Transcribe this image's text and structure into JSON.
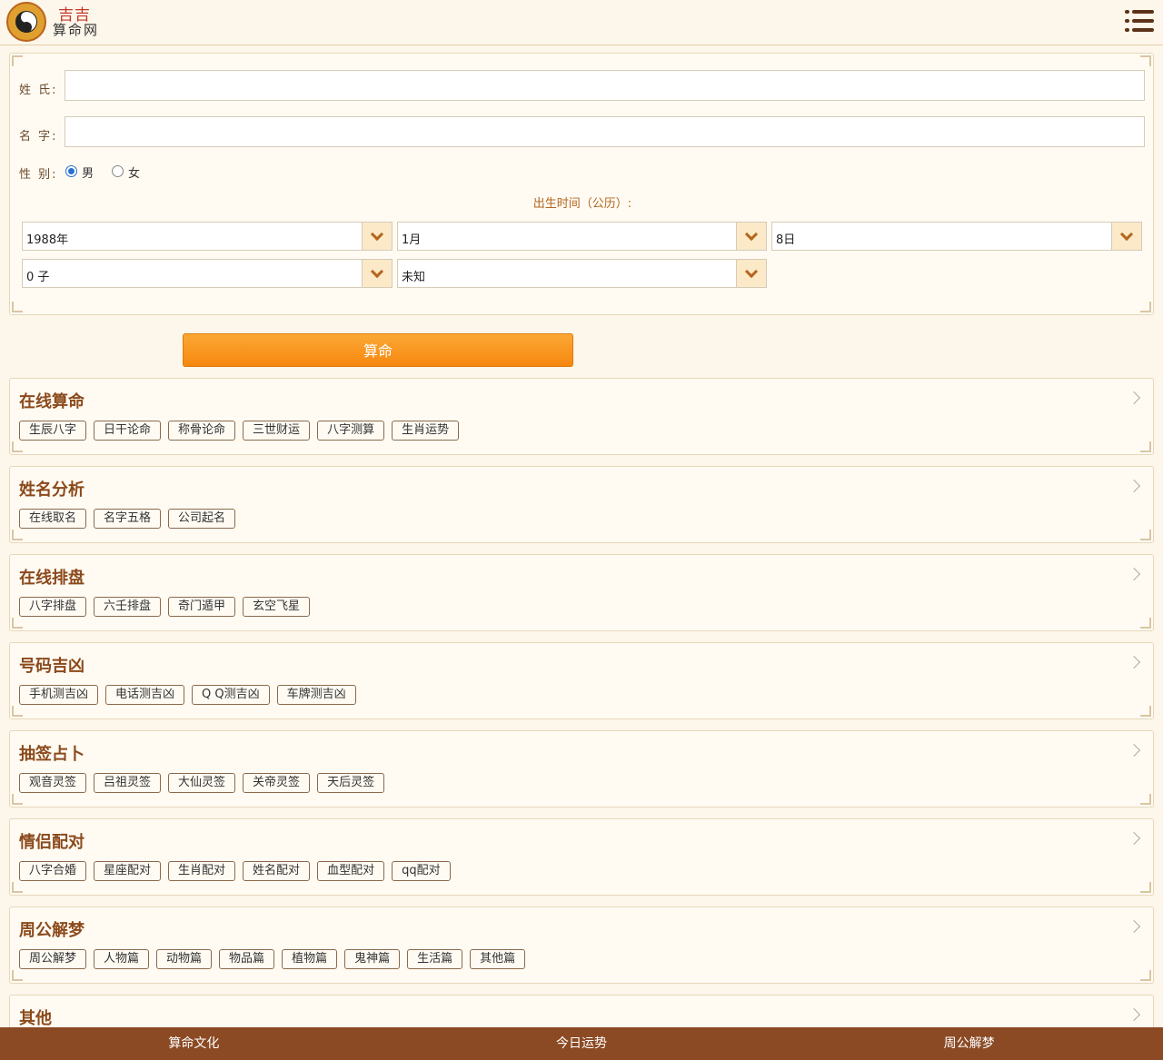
{
  "header": {
    "logo_top": "吉吉",
    "logo_bottom": "算命网",
    "menu_icon": "list-menu-icon"
  },
  "form": {
    "surname_label": "姓 氏:",
    "given_name_label": "名 字:",
    "gender_label": "性 别:",
    "gender_male": "男",
    "gender_female": "女",
    "gender_selected": "男",
    "birth_title": "出生时间（公历）:",
    "year": "1988年",
    "month": "1月",
    "day": "8日",
    "hour": "0 子",
    "minute": "未知",
    "submit_label": "算命"
  },
  "categories": [
    {
      "title": "在线算命",
      "tags": [
        "生辰八字",
        "日干论命",
        "称骨论命",
        "三世财运",
        "八字测算",
        "生肖运势"
      ]
    },
    {
      "title": "姓名分析",
      "tags": [
        "在线取名",
        "名字五格",
        "公司起名"
      ]
    },
    {
      "title": "在线排盘",
      "tags": [
        "八字排盘",
        "六壬排盘",
        "奇门遁甲",
        "玄空飞星"
      ]
    },
    {
      "title": "号码吉凶",
      "tags": [
        "手机测吉凶",
        "电话测吉凶",
        "Q Q测吉凶",
        "车牌测吉凶"
      ]
    },
    {
      "title": "抽签占卜",
      "tags": [
        "观音灵签",
        "吕祖灵签",
        "大仙灵签",
        "关帝灵签",
        "天后灵签"
      ]
    },
    {
      "title": "情侣配对",
      "tags": [
        "八字合婚",
        "星座配对",
        "生肖配对",
        "姓名配对",
        "血型配对",
        "qq配对"
      ]
    },
    {
      "title": "周公解梦",
      "tags": [
        "周公解梦",
        "人物篇",
        "动物篇",
        "物品篇",
        "植物篇",
        "鬼神篇",
        "生活篇",
        "其他篇"
      ]
    },
    {
      "title": "其他",
      "tags": []
    }
  ],
  "footer": {
    "items": [
      "算命文化",
      "今日运势",
      "周公解梦"
    ]
  },
  "colors": {
    "background": "#fdf6ea",
    "accent_orange": "#f6870f",
    "title_brown": "#8b4a1c",
    "footer_bg": "#8b4a24"
  }
}
